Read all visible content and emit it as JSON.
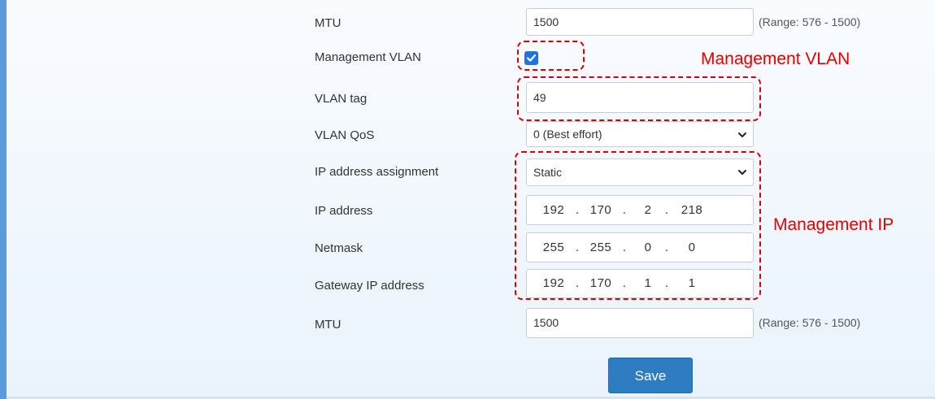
{
  "form": {
    "mtu_top": {
      "label": "MTU",
      "value": "1500",
      "range": "(Range: 576 - 1500)"
    },
    "management_vlan": {
      "label": "Management VLAN",
      "checked": true
    },
    "vlan_tag": {
      "label": "VLAN tag",
      "value": "49"
    },
    "vlan_qos": {
      "label": "VLAN QoS",
      "selected": "0 (Best effort)"
    },
    "ip_assignment": {
      "label": "IP address assignment",
      "selected": "Static"
    },
    "ip_address": {
      "label": "IP address",
      "octets": [
        "192",
        "170",
        "2",
        "218"
      ]
    },
    "netmask": {
      "label": "Netmask",
      "octets": [
        "255",
        "255",
        "0",
        "0"
      ]
    },
    "gateway": {
      "label": "Gateway IP address",
      "octets": [
        "192",
        "170",
        "1",
        "1"
      ]
    },
    "mtu_bottom": {
      "label": "MTU",
      "value": "1500",
      "range": "(Range: 576 - 1500)"
    },
    "save_label": "Save",
    "octet_separator": "."
  },
  "annotations": {
    "management_vlan": "Management VLAN",
    "management_ip": "Management IP"
  },
  "colors": {
    "annotation": "#e00000",
    "save_button": "#2e7cc2",
    "checkbox": "#1a73e8",
    "accent_bar": "#5a9bdc"
  },
  "icons": {
    "checkbox": "checkmark-icon",
    "select": "chevron-down-icon"
  }
}
